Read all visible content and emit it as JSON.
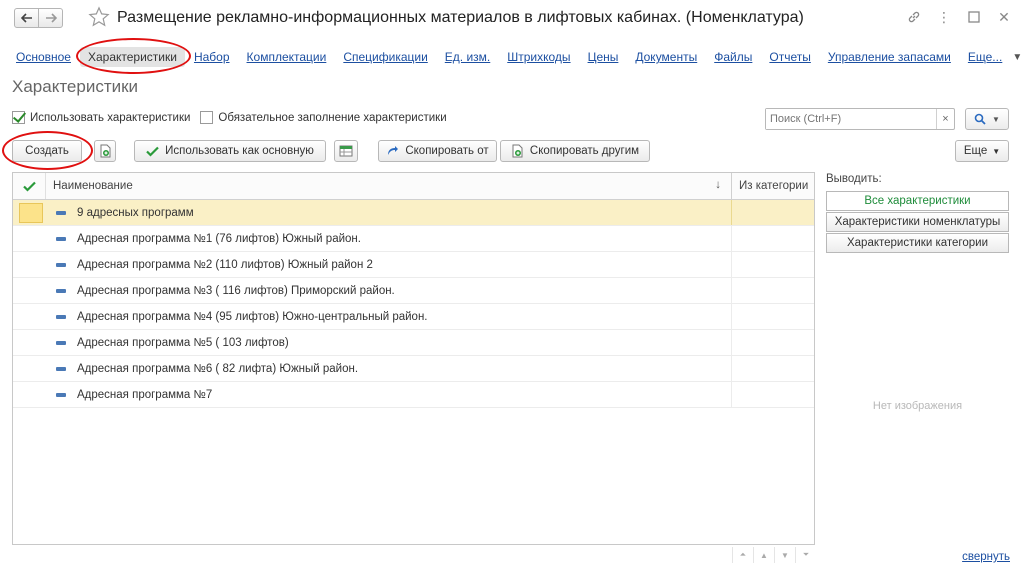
{
  "window": {
    "title": "Размещение рекламно-информационных материалов в лифтовых кабинах. (Номенклатура)"
  },
  "tabs": {
    "items": [
      "Основное",
      "Характеристики",
      "Набор",
      "Комплектации",
      "Спецификации",
      "Ед. изм.",
      "Штрихкоды",
      "Цены",
      "Документы",
      "Файлы",
      "Отчеты",
      "Управление запасами"
    ],
    "more": "Еще...",
    "active": "Характеристики"
  },
  "section": {
    "title": "Характеристики"
  },
  "options": {
    "use_characteristics": {
      "label": "Использовать характеристики",
      "checked": true
    },
    "mandatory_fill": {
      "label": "Обязательное заполнение характеристики",
      "checked": false
    }
  },
  "search": {
    "placeholder": "Поиск (Ctrl+F)"
  },
  "toolbar": {
    "create": "Создать",
    "use_as_main": "Использовать как основную",
    "copy_from": "Скопировать от",
    "copy_to_others": "Скопировать другим",
    "more": "Еще"
  },
  "table": {
    "columns": {
      "name": "Наименование",
      "from_category": "Из категории"
    },
    "rows": [
      "9 адресных программ",
      "Адресная программа №1 (76 лифтов) Южный район.",
      "Адресная программа №2 (110 лифтов) Южный район 2",
      "Адресная программа №3 ( 116 лифтов) Приморский район.",
      "Адресная программа №4 (95 лифтов) Южно-центральный район.",
      "Адресная программа №5 ( 103 лифтов)",
      "Адресная программа №6 ( 82 лифта) Южный район.",
      "Адресная программа №7"
    ],
    "selected_row": 0
  },
  "side_panel": {
    "label": "Выводить:",
    "buttons": [
      "Все характеристики",
      "Характеристики номенклатуры",
      "Характеристики категории"
    ],
    "active": 0,
    "no_image": "Нет изображения"
  },
  "footer": {
    "collapse": "свернуть"
  },
  "colors": {
    "accent_green": "#1e8c3a",
    "link_blue": "#1c4fa1",
    "annotation_red": "#e01010",
    "selection": "#faf0c6"
  }
}
